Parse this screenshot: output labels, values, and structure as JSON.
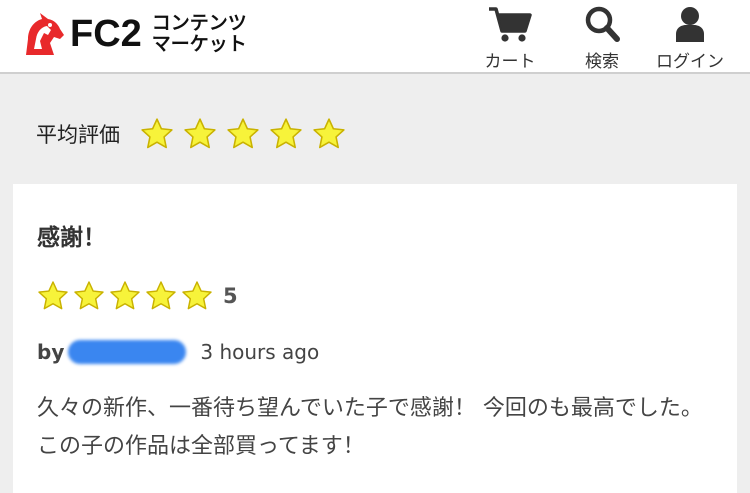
{
  "header": {
    "logo": {
      "brand": "FC2",
      "sub_line1": "コンテンツ",
      "sub_line2": "マーケット"
    },
    "nav": {
      "cart_label": "カート",
      "search_label": "検索",
      "login_label": "ログイン"
    }
  },
  "average": {
    "label": "平均評価",
    "stars": 5,
    "max_stars": 5
  },
  "review": {
    "title": "感謝！",
    "stars": 5,
    "score": "5",
    "by_label": "by",
    "author_hidden": true,
    "time": "3 hours ago",
    "body": "久々の新作、一番待ち望んでいた子で感謝！ 今回のも最高でした。この子の作品は全部買ってます！"
  },
  "colors": {
    "star_fill": "#f7f33a",
    "star_stroke": "#c9b200",
    "logo_red": "#e8292b",
    "background": "#eeeeee",
    "author_blur": "#3a86f0"
  },
  "icons": [
    "cart-icon",
    "search-icon",
    "user-icon",
    "star-icon",
    "unicorn-logo-icon"
  ]
}
